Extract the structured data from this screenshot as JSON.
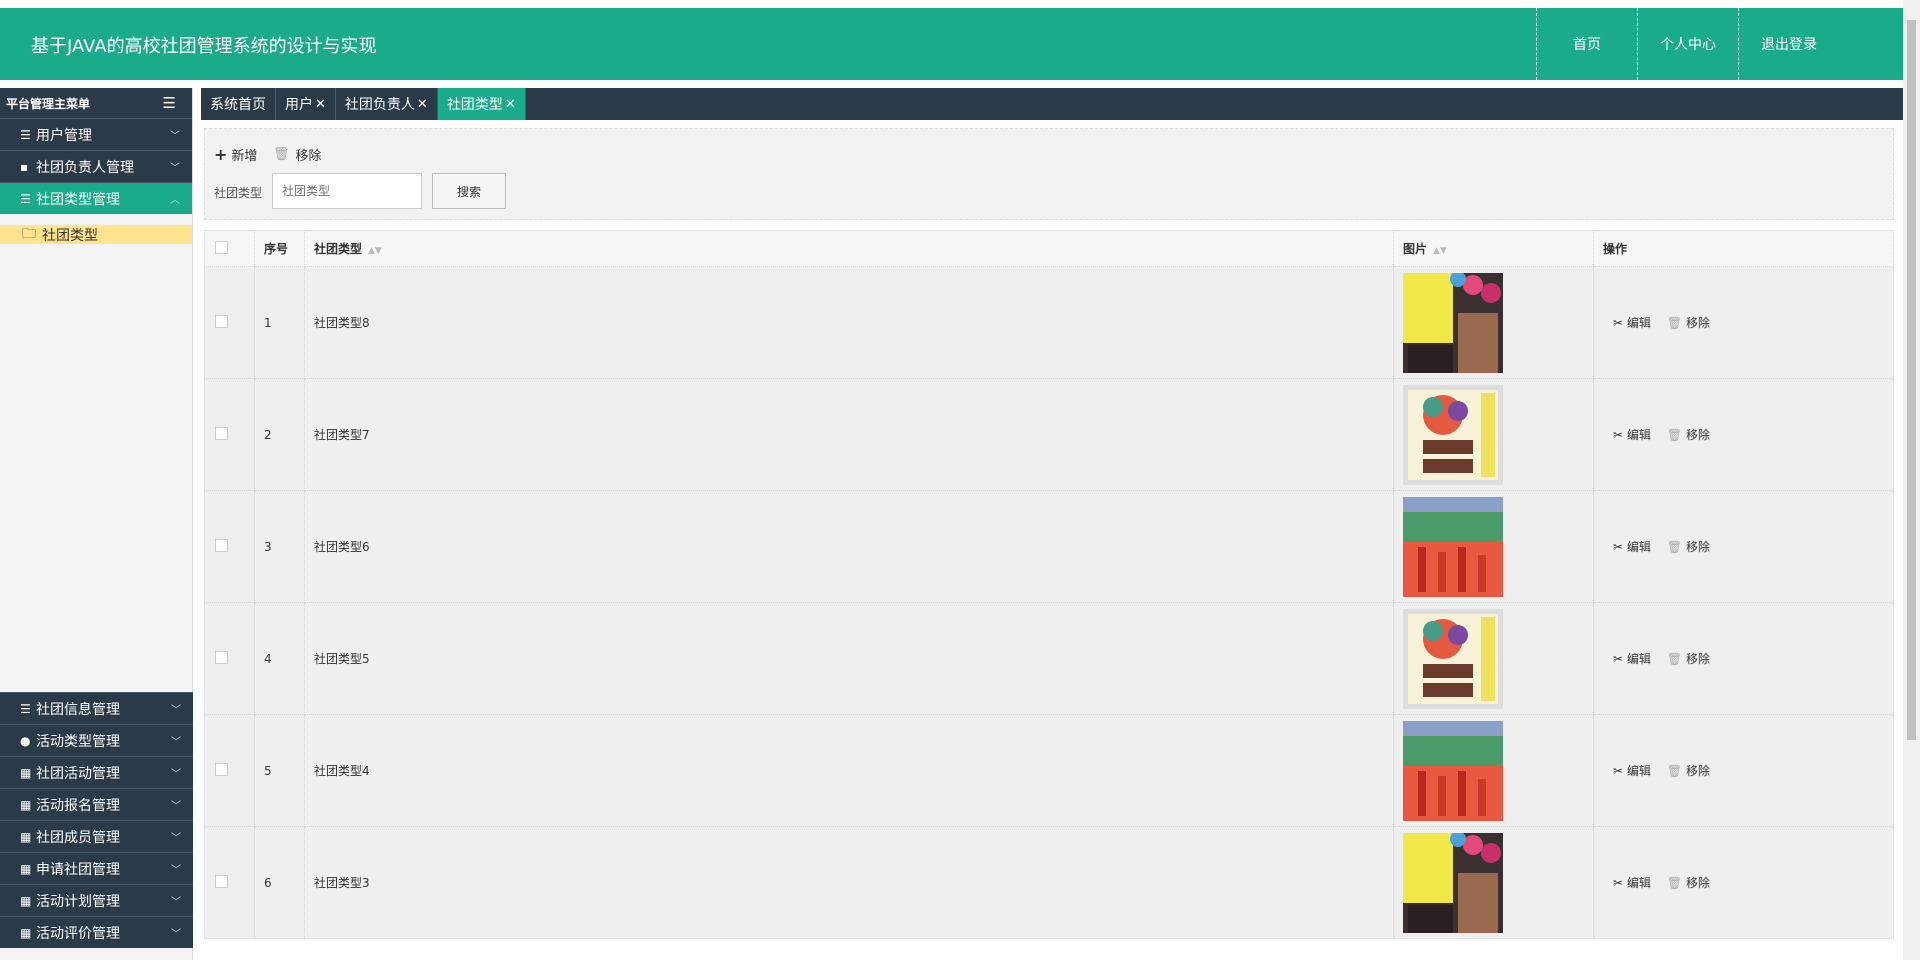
{
  "header": {
    "title": "基于JAVA的高校社团管理系统的设计与实现",
    "nav": [
      "首页",
      "个人中心",
      "退出登录"
    ],
    "bg": "#1aab8b"
  },
  "sidebar": {
    "title": "平台管理主菜单",
    "menus_top": [
      {
        "label": "用户管理",
        "icon": "sliders-icon",
        "glyph": "☰"
      },
      {
        "label": "社团负责人管理",
        "icon": "comment-icon",
        "glyph": "▪"
      },
      {
        "label": "社团类型管理",
        "icon": "list-icon",
        "glyph": "☰",
        "active": true
      }
    ],
    "sub_item": "社团类型",
    "menus_bottom": [
      {
        "label": "社团信息管理",
        "icon": "list-icon",
        "glyph": "☰"
      },
      {
        "label": "活动类型管理",
        "icon": "user-icon",
        "glyph": "●"
      },
      {
        "label": "社团活动管理",
        "icon": "grid-icon",
        "glyph": "▦"
      },
      {
        "label": "活动报名管理",
        "icon": "grid-icon",
        "glyph": "▦"
      },
      {
        "label": "社团成员管理",
        "icon": "grid-icon",
        "glyph": "▦"
      },
      {
        "label": "申请社团管理",
        "icon": "grid-icon",
        "glyph": "▦"
      },
      {
        "label": "活动计划管理",
        "icon": "grid-icon",
        "glyph": "▦"
      },
      {
        "label": "活动评价管理",
        "icon": "grid-icon",
        "glyph": "▦"
      }
    ]
  },
  "tabs": [
    {
      "label": "系统首页",
      "closable": false
    },
    {
      "label": "用户",
      "closable": true
    },
    {
      "label": "社团负责人",
      "closable": true
    },
    {
      "label": "社团类型",
      "closable": true,
      "active": true
    }
  ],
  "toolbar": {
    "add_label": "新增",
    "delete_label": "移除",
    "search_label": "社团类型",
    "search_placeholder": "社团类型",
    "search_button": "搜索"
  },
  "table": {
    "headers": [
      "序号",
      "社团类型",
      "图片",
      "操作"
    ],
    "edit_label": "编辑",
    "delete_label": "移除",
    "rows": [
      {
        "no": "1",
        "type": "社团类型8",
        "image": "poster-notes"
      },
      {
        "no": "2",
        "type": "社团类型7",
        "image": "poster-recruit"
      },
      {
        "no": "3",
        "type": "社团类型6",
        "image": "poster-hands"
      },
      {
        "no": "4",
        "type": "社团类型5",
        "image": "poster-recruit"
      },
      {
        "no": "5",
        "type": "社团类型4",
        "image": "poster-hands"
      },
      {
        "no": "6",
        "type": "社团类型3",
        "image": "poster-notes"
      }
    ]
  }
}
